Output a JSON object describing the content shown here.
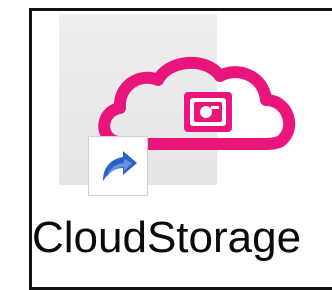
{
  "desktop_shortcut": {
    "label": "CloudStorage",
    "icon": "cloud-storage-icon",
    "overlay_icon": "shortcut-arrow-icon",
    "colors": {
      "brand": "#e9157c",
      "arrow": "#2a63c4",
      "tile": "#e8e8e8"
    }
  }
}
